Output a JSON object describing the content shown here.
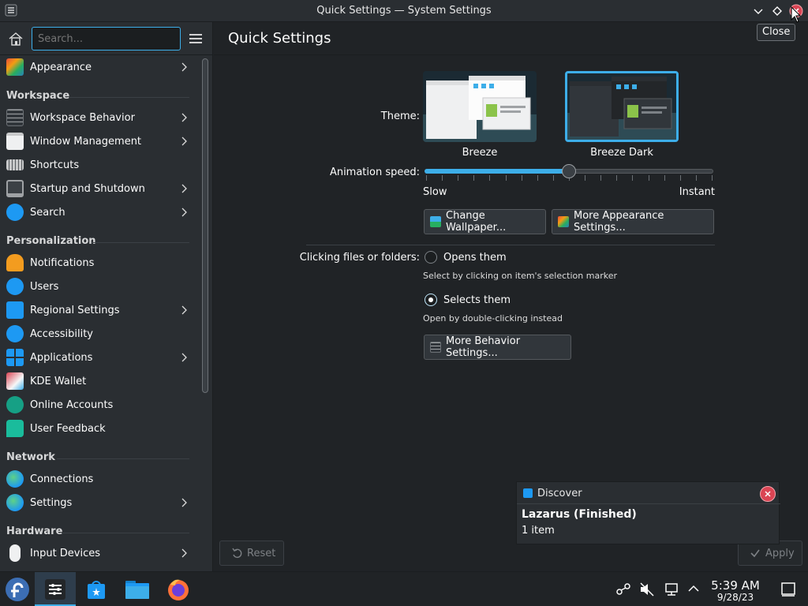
{
  "window": {
    "title": "Quick Settings — System Settings",
    "tooltip": "Close"
  },
  "sidebar": {
    "search_placeholder": "Search...",
    "items": [
      {
        "label": "Appearance",
        "icon": "appearance-icon",
        "chevron": true
      },
      {
        "section": "Workspace"
      },
      {
        "label": "Workspace Behavior",
        "icon": "workspace-behavior-icon",
        "chevron": true
      },
      {
        "label": "Window Management",
        "icon": "window-management-icon",
        "chevron": true
      },
      {
        "label": "Shortcuts",
        "icon": "keyboard-icon",
        "chevron": false
      },
      {
        "label": "Startup and Shutdown",
        "icon": "startup-icon",
        "chevron": true
      },
      {
        "label": "Search",
        "icon": "search-icon",
        "chevron": true
      },
      {
        "section": "Personalization"
      },
      {
        "label": "Notifications",
        "icon": "bell-icon",
        "chevron": false
      },
      {
        "label": "Users",
        "icon": "users-icon",
        "chevron": false
      },
      {
        "label": "Regional Settings",
        "icon": "regional-icon",
        "chevron": true
      },
      {
        "label": "Accessibility",
        "icon": "accessibility-icon",
        "chevron": false
      },
      {
        "label": "Applications",
        "icon": "applications-icon",
        "chevron": true
      },
      {
        "label": "KDE Wallet",
        "icon": "wallet-icon",
        "chevron": false
      },
      {
        "label": "Online Accounts",
        "icon": "online-accounts-icon",
        "chevron": false
      },
      {
        "label": "User Feedback",
        "icon": "feedback-icon",
        "chevron": false
      },
      {
        "section": "Network"
      },
      {
        "label": "Connections",
        "icon": "globe-icon",
        "chevron": false
      },
      {
        "label": "Settings",
        "icon": "globe-settings-icon",
        "chevron": true
      },
      {
        "section": "Hardware"
      },
      {
        "label": "Input Devices",
        "icon": "mouse-icon",
        "chevron": true
      }
    ]
  },
  "main": {
    "title": "Quick Settings",
    "theme_label": "Theme:",
    "themes": [
      {
        "name": "Breeze",
        "selected": false
      },
      {
        "name": "Breeze Dark",
        "selected": true
      }
    ],
    "animation_label": "Animation speed:",
    "animation_value": 0.5,
    "slider_min_label": "Slow",
    "slider_max_label": "Instant",
    "change_wallpaper": "Change Wallpaper...",
    "more_appearance": "More Appearance Settings...",
    "clicking_label": "Clicking files or folders:",
    "option_open": "Opens them",
    "option_open_hint": "Select by clicking on item's selection marker",
    "option_select": "Selects them",
    "option_select_hint": "Open by double-clicking instead",
    "more_behavior": "More Behavior Settings...",
    "reset": "Reset",
    "apply": "Apply"
  },
  "notification": {
    "app": "Discover",
    "title": "Lazarus (Finished)",
    "body": "1 item"
  },
  "taskbar": {
    "time": "5:39 AM",
    "date": "9/28/23"
  },
  "colors": {
    "accent": "#3daee9",
    "close_red": "#da4453"
  }
}
